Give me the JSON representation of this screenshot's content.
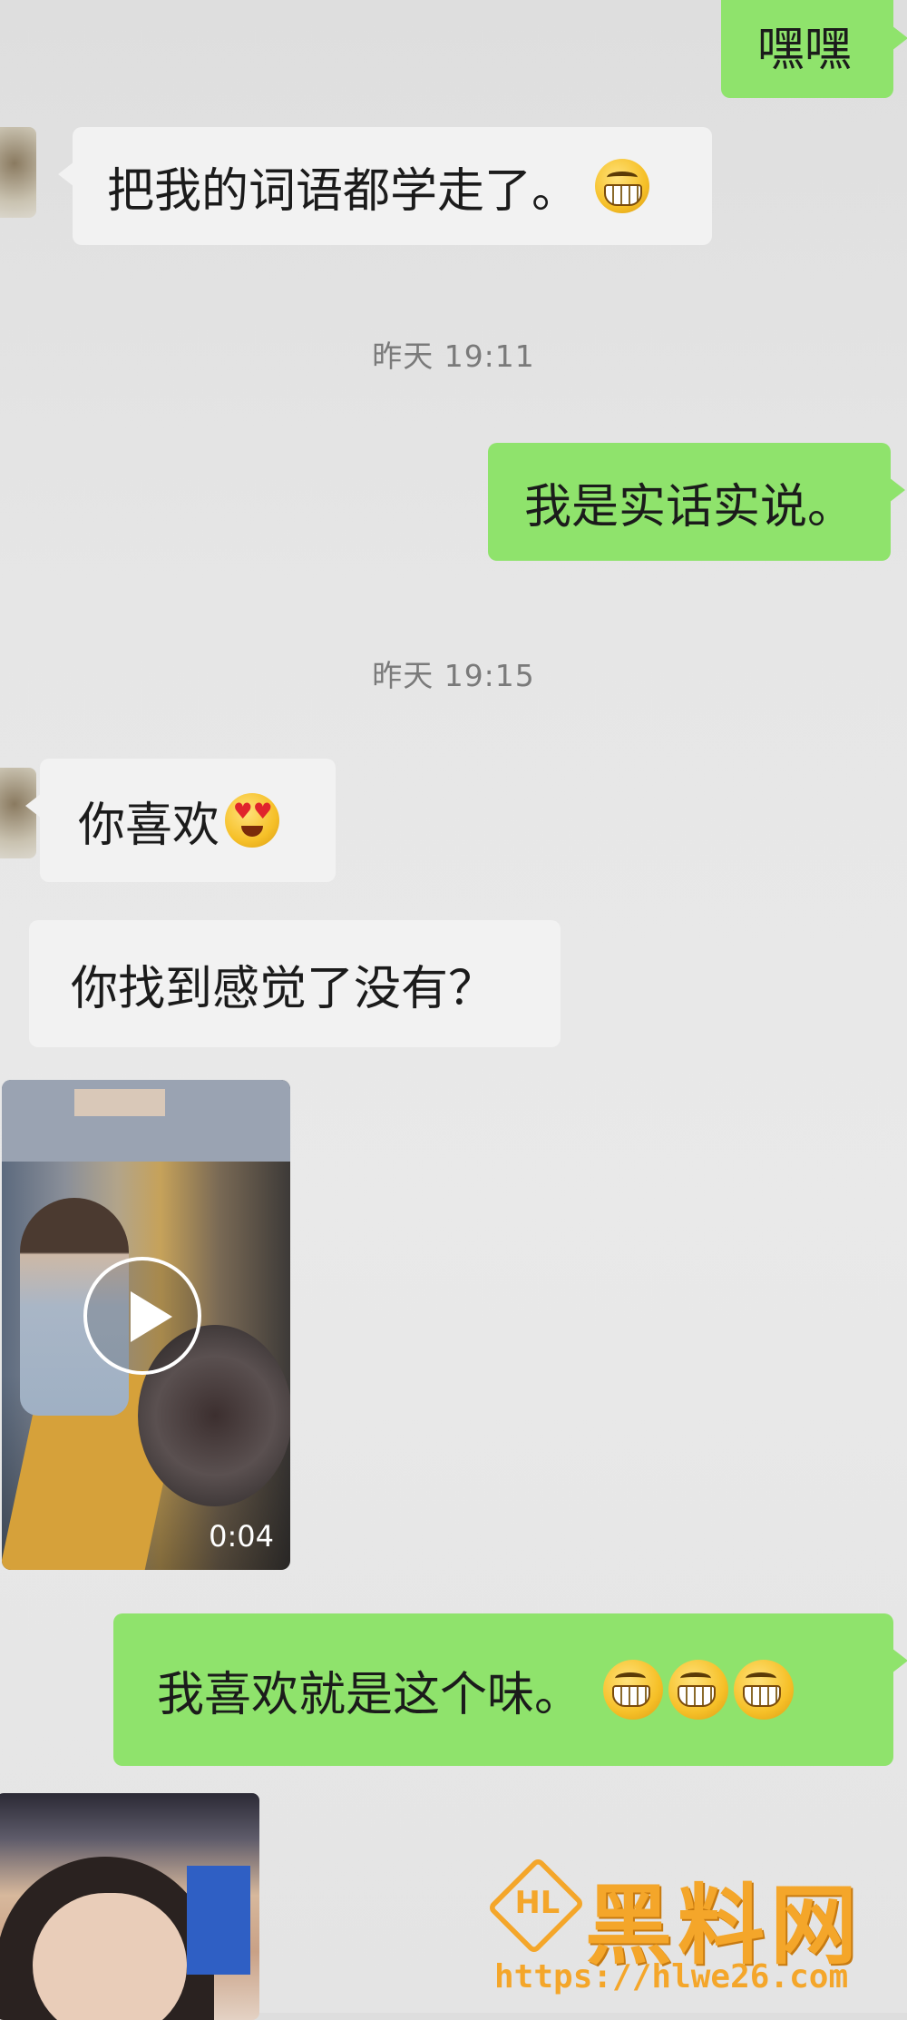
{
  "messages": [
    {
      "side": "out",
      "text": "嘿嘿"
    },
    {
      "side": "in",
      "text": "把我的词语都学走了。",
      "emoji": [
        "grin-emoji"
      ]
    },
    {
      "time": "昨天 19:11"
    },
    {
      "side": "out",
      "text": "我是实话实说。"
    },
    {
      "time": "昨天 19:15"
    },
    {
      "side": "in",
      "text": "你喜欢",
      "emoji": [
        "heart-eyes-emoji"
      ]
    },
    {
      "side": "in",
      "text": "你找到感觉了没有？"
    },
    {
      "side": "in",
      "type": "video",
      "duration": "0:04"
    },
    {
      "side": "out",
      "text": "我喜欢就是这个味。",
      "emoji": [
        "grin-emoji",
        "grin-emoji",
        "grin-emoji"
      ]
    },
    {
      "side": "in",
      "type": "photo"
    }
  ],
  "watermark": {
    "logo": "HL",
    "title": "黑料网",
    "url": "https://hlwe26.com"
  },
  "colors": {
    "outgoing_bubble": "#8fe36c",
    "incoming_bubble": "#f2f2f2",
    "background": "#e6e6e6",
    "watermark": "#f4a62a"
  }
}
